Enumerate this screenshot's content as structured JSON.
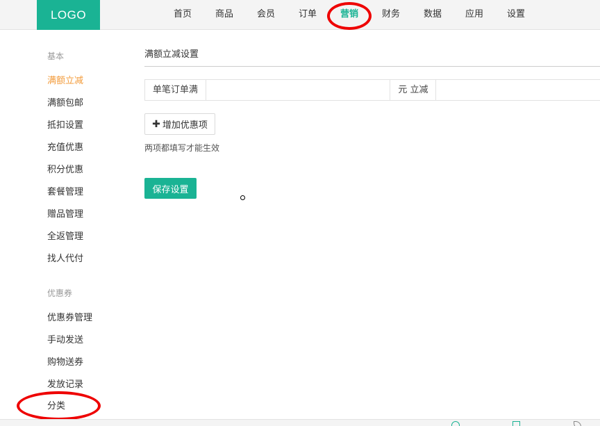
{
  "header": {
    "logo": "LOGO",
    "nav": [
      {
        "label": "首页",
        "active": false
      },
      {
        "label": "商品",
        "active": false
      },
      {
        "label": "会员",
        "active": false
      },
      {
        "label": "订单",
        "active": false
      },
      {
        "label": "营销",
        "active": true
      },
      {
        "label": "财务",
        "active": false
      },
      {
        "label": "数据",
        "active": false
      },
      {
        "label": "应用",
        "active": false
      },
      {
        "label": "设置",
        "active": false
      }
    ]
  },
  "sidebar": {
    "section_basic": "基本",
    "basic_items": [
      {
        "label": "满额立减",
        "active": true
      },
      {
        "label": "满额包邮",
        "active": false
      },
      {
        "label": "抵扣设置",
        "active": false
      },
      {
        "label": "充值优惠",
        "active": false
      },
      {
        "label": "积分优惠",
        "active": false
      },
      {
        "label": "套餐管理",
        "active": false
      },
      {
        "label": "赠品管理",
        "active": false
      },
      {
        "label": "全返管理",
        "active": false
      },
      {
        "label": "找人代付",
        "active": false
      }
    ],
    "section_coupon": "优惠券",
    "coupon_items": [
      {
        "label": "优惠券管理",
        "active": false
      },
      {
        "label": "手动发送",
        "active": false
      },
      {
        "label": "购物送券",
        "active": false
      },
      {
        "label": "发放记录",
        "active": false
      },
      {
        "label": "分类",
        "active": false
      }
    ]
  },
  "main": {
    "title": "满额立减设置",
    "condition": {
      "label": "单笔订单满",
      "amount_value": "",
      "unit_label": "元 立减",
      "discount_value": ""
    },
    "add_button": "增加优惠项",
    "hint": "两项都填写才能生效",
    "save_button": "保存设置"
  },
  "icons": {
    "add": "plus-icon"
  },
  "colors": {
    "brand": "#1ab394",
    "active_side": "#f39c3c",
    "annotation": "#ee0000"
  }
}
